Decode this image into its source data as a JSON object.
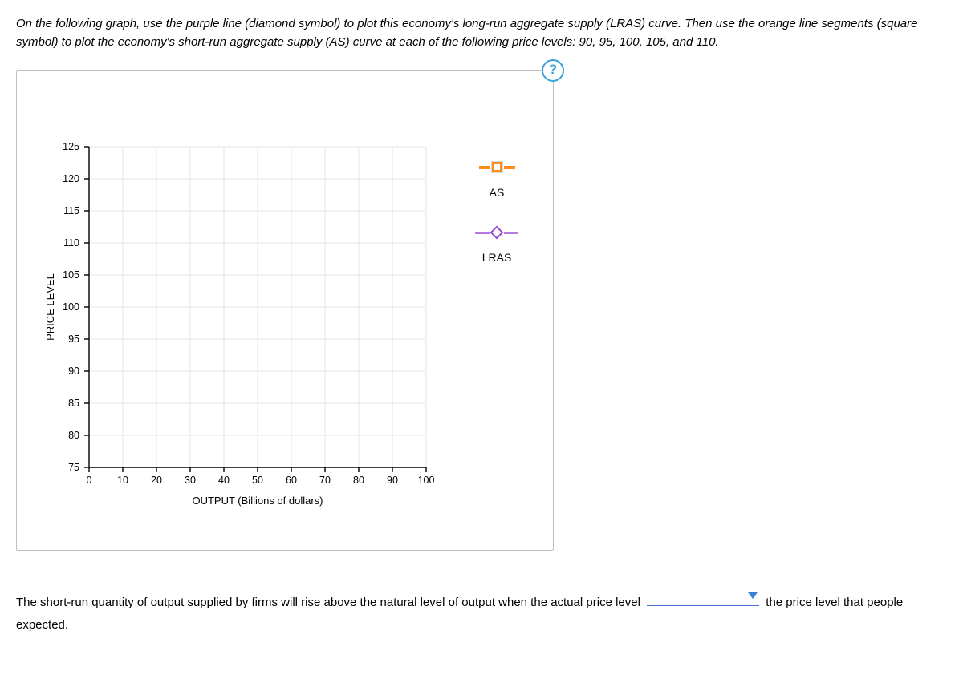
{
  "instructions": "On the following graph, use the purple line (diamond symbol) to plot this economy's long-run aggregate supply (LRAS) curve. Then use the orange line segments (square symbol) to plot the economy's short-run aggregate supply (AS) curve at each of the following price levels: 90, 95, 100, 105, and 110.",
  "help_icon": "?",
  "legend": {
    "as_label": "AS",
    "lras_label": "LRAS"
  },
  "answer": {
    "part1": "The short-run quantity of output supplied by firms will rise above the natural level of output when the actual price level",
    "part2": "the price level that people expected."
  },
  "chart_data": {
    "type": "scatter",
    "title": "",
    "xlabel": "OUTPUT (Billions of dollars)",
    "ylabel": "PRICE LEVEL",
    "xlim": [
      0,
      100
    ],
    "ylim": [
      75,
      125
    ],
    "x_ticks": [
      0,
      10,
      20,
      30,
      40,
      50,
      60,
      70,
      80,
      90,
      100
    ],
    "y_ticks": [
      75,
      80,
      85,
      90,
      95,
      100,
      105,
      110,
      115,
      120,
      125
    ],
    "series": [
      {
        "name": "AS",
        "symbol": "square",
        "color": "#ff8c1a",
        "values": []
      },
      {
        "name": "LRAS",
        "symbol": "diamond",
        "color": "#b47ae0",
        "values": []
      }
    ],
    "grid": true
  }
}
